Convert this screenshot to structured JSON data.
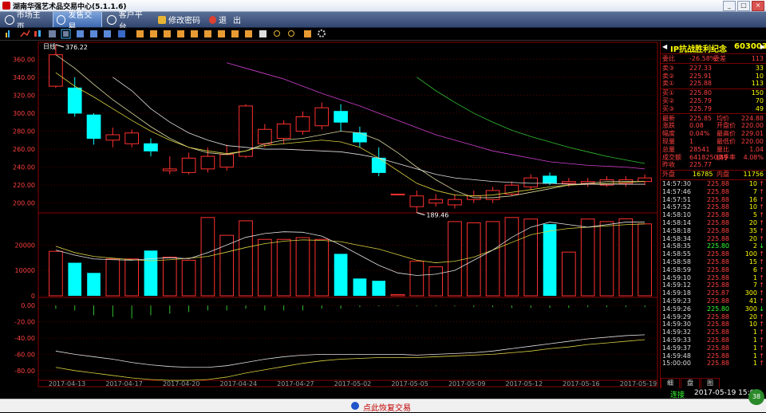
{
  "window": {
    "title": "湖南华强艺术品交易中心(5.1.1.6)"
  },
  "menu": [
    {
      "label": "市场主页",
      "icon": "globe-icon"
    },
    {
      "label": "发售交易",
      "icon": "globe-icon",
      "active": true
    },
    {
      "label": "客户平台",
      "icon": "globe-icon"
    },
    {
      "label": "修改密码",
      "icon": "lock-icon"
    },
    {
      "label": "退",
      "icon": "exit-icon"
    },
    {
      "label": "出",
      "icon": ""
    }
  ],
  "chart_data": {
    "type": "candlestick",
    "title": "日线",
    "price_axis": [
      360,
      340,
      320,
      300,
      280,
      260,
      240,
      220,
      200
    ],
    "volume_axis": [
      20000,
      10000,
      0
    ],
    "macd_axis": [
      "0.00",
      "-20.00",
      "-40.00",
      "-60.00",
      "-80.00"
    ],
    "macd_ylim": [
      -90,
      8
    ],
    "max_label": "376.22",
    "min_label": "189.46",
    "dates": [
      "2017-04-13",
      "2017-04-17",
      "2017-04-20",
      "2017-04-24",
      "2017-04-27",
      "2017-05-02",
      "2017-05-05",
      "2017-05-09",
      "2017-05-12",
      "2017-05-16",
      "2017-05-19"
    ],
    "candles": [
      {
        "o": 330,
        "c": 365,
        "h": 376.22,
        "l": 328,
        "v": 17500
      },
      {
        "o": 328,
        "c": 300,
        "h": 340,
        "l": 296,
        "v": 13000
      },
      {
        "o": 298,
        "c": 272,
        "h": 300,
        "l": 265,
        "v": 9000
      },
      {
        "o": 270,
        "c": 276,
        "h": 284,
        "l": 262,
        "v": 14500
      },
      {
        "o": 266,
        "c": 278,
        "h": 282,
        "l": 262,
        "v": 14500
      },
      {
        "o": 266,
        "c": 258,
        "h": 272,
        "l": 252,
        "v": 17800
      },
      {
        "o": 236,
        "c": 238,
        "h": 252,
        "l": 232,
        "v": 15200
      },
      {
        "o": 234,
        "c": 250,
        "h": 256,
        "l": 232,
        "v": 14000
      },
      {
        "o": 238,
        "c": 252,
        "h": 262,
        "l": 234,
        "v": 30800
      },
      {
        "o": 240,
        "c": 254,
        "h": 265,
        "l": 236,
        "v": 23800
      },
      {
        "o": 252,
        "c": 308,
        "h": 310,
        "l": 250,
        "v": 29500
      },
      {
        "o": 266,
        "c": 282,
        "h": 288,
        "l": 262,
        "v": 22200
      },
      {
        "o": 272,
        "c": 288,
        "h": 292,
        "l": 266,
        "v": 22200
      },
      {
        "o": 280,
        "c": 296,
        "h": 302,
        "l": 276,
        "v": 22900
      },
      {
        "o": 286,
        "c": 306,
        "h": 312,
        "l": 282,
        "v": 22200
      },
      {
        "o": 302,
        "c": 290,
        "h": 310,
        "l": 280,
        "v": 16500
      },
      {
        "o": 278,
        "c": 268,
        "h": 285,
        "l": 262,
        "v": 6800
      },
      {
        "o": 250,
        "c": 234,
        "h": 262,
        "l": 230,
        "v": 5900
      },
      {
        "o": 210,
        "c": 210,
        "h": 210,
        "l": 210,
        "v": 500
      },
      {
        "o": 196,
        "c": 208,
        "h": 214,
        "l": 189.46,
        "v": 13600
      },
      {
        "o": 200,
        "c": 204,
        "h": 210,
        "l": 196,
        "v": 11400
      },
      {
        "o": 198,
        "c": 204,
        "h": 210,
        "l": 194,
        "v": 29200
      },
      {
        "o": 204,
        "c": 208,
        "h": 214,
        "l": 200,
        "v": 28700
      },
      {
        "o": 204,
        "c": 214,
        "h": 218,
        "l": 200,
        "v": 29200
      },
      {
        "o": 210,
        "c": 220,
        "h": 224,
        "l": 208,
        "v": 30800
      },
      {
        "o": 218,
        "c": 228,
        "h": 232,
        "l": 214,
        "v": 30200
      },
      {
        "o": 230,
        "c": 222,
        "h": 234,
        "l": 220,
        "v": 28200
      },
      {
        "o": 222,
        "c": 224,
        "h": 228,
        "l": 218,
        "v": 17200
      },
      {
        "o": 222,
        "c": 224,
        "h": 228,
        "l": 218,
        "v": 30200
      },
      {
        "o": 220,
        "c": 226,
        "h": 230,
        "l": 218,
        "v": 29200
      },
      {
        "o": 222,
        "c": 226,
        "h": 230,
        "l": 218,
        "v": 30300
      },
      {
        "o": 224,
        "c": 228,
        "h": 232,
        "l": 220,
        "v": 28300
      }
    ],
    "ma_yellow": [
      345,
      330,
      318,
      305,
      292,
      280,
      270,
      262,
      258,
      255,
      258,
      264,
      266,
      268,
      270,
      268,
      262,
      250,
      236,
      222,
      214,
      209,
      208,
      209,
      212,
      215,
      218,
      220,
      221,
      222,
      223,
      224
    ],
    "ma_light": [
      365,
      350,
      332,
      315,
      300,
      285,
      272,
      262,
      256,
      254,
      258,
      266,
      270,
      272,
      276,
      280,
      278,
      270,
      256,
      240,
      226,
      214,
      206,
      206,
      208,
      212,
      216,
      220,
      222,
      224,
      224,
      224
    ],
    "ma_magenta": [
      null,
      null,
      null,
      null,
      null,
      null,
      null,
      null,
      null,
      356,
      350,
      344,
      338,
      330,
      322,
      315,
      308,
      300,
      292,
      284,
      276,
      270,
      264,
      258,
      254,
      250,
      246,
      244,
      242,
      241,
      240,
      238
    ],
    "ma_white_price": [
      null,
      null,
      null,
      340,
      325,
      305,
      290,
      278,
      270,
      264,
      262,
      260,
      260,
      259,
      258,
      257,
      254,
      250,
      244,
      238,
      232,
      228,
      226,
      224,
      223,
      222,
      222,
      221,
      221,
      221,
      221,
      221
    ],
    "ma_green": [
      null,
      null,
      null,
      null,
      null,
      null,
      null,
      null,
      null,
      null,
      null,
      null,
      null,
      null,
      null,
      null,
      null,
      null,
      null,
      340,
      325,
      312,
      300,
      290,
      281,
      274,
      268,
      262,
      257,
      252,
      248,
      244
    ],
    "vol_ma_yellow": [
      19500,
      17000,
      15500,
      14800,
      14200,
      13800,
      14200,
      14800,
      15500,
      17200,
      19000,
      20500,
      21500,
      22000,
      21800,
      21300,
      19800,
      18400,
      16200,
      14000,
      13000,
      13600,
      15200,
      18000,
      21000,
      24000,
      25500,
      26500,
      27000,
      27500,
      28000,
      28300
    ],
    "vol_ma_white": [
      18000,
      16000,
      14500,
      14200,
      14000,
      14600,
      15000,
      14600,
      17000,
      20000,
      23000,
      24500,
      25200,
      25000,
      23500,
      20000,
      16000,
      12000,
      9000,
      8000,
      8500,
      10000,
      14000,
      18000,
      23000,
      27000,
      29000,
      28000,
      27000,
      28000,
      29000,
      29000
    ],
    "macd_bars": [
      -4,
      -6,
      -12,
      -14,
      -16,
      -12,
      -10,
      -8,
      -6,
      -6,
      -4,
      -6,
      -6,
      -6,
      -4,
      -4,
      -2,
      -1,
      -1,
      -1,
      -1,
      -1,
      -2,
      -2,
      -3,
      -3,
      -3,
      -3,
      -2,
      -2,
      -2,
      -2
    ],
    "dif": [
      -56,
      -60,
      -63,
      -66,
      -70,
      -73,
      -75,
      -76,
      -76,
      -74,
      -70,
      -66,
      -63,
      -61,
      -60,
      -60,
      -60,
      -60,
      -60,
      -61,
      -60,
      -59,
      -58,
      -56,
      -53,
      -50,
      -47,
      -44,
      -41,
      -39,
      -37,
      -36
    ],
    "dea": [
      -76,
      -80,
      -83,
      -86,
      -89,
      -91,
      -92,
      -92,
      -91,
      -88,
      -83,
      -79,
      -75,
      -71,
      -68,
      -66,
      -65,
      -64,
      -64,
      -64,
      -63,
      -62,
      -61,
      -60,
      -58,
      -56,
      -53,
      -51,
      -48,
      -46,
      -44,
      -42
    ]
  },
  "quote": {
    "name": "IP抗战胜利纪念",
    "code": "603003",
    "ratio": {
      "l1": "委比",
      "v1": "-26.58%",
      "l2": "委差",
      "v2": "113"
    },
    "sell": [
      {
        "label": "卖③",
        "price": "227.33",
        "vol": "33"
      },
      {
        "label": "卖②",
        "price": "225.91",
        "vol": "10"
      },
      {
        "label": "卖①",
        "price": "225.88",
        "vol": "113"
      }
    ],
    "buy": [
      {
        "label": "买①",
        "price": "225.80",
        "vol": "150"
      },
      {
        "label": "买②",
        "price": "225.79",
        "vol": "70"
      },
      {
        "label": "买③",
        "price": "225.79",
        "vol": "49"
      }
    ],
    "stats": [
      {
        "l1": "最新",
        "v1": "225.85",
        "l2": "均价",
        "v2": "224.88"
      },
      {
        "l1": "涨跌",
        "v1": "0.08",
        "l2": "开盘价",
        "v2": "220.00"
      },
      {
        "l1": "幅度",
        "v1": "0.04%",
        "l2": "最高价",
        "v2": "229.01"
      },
      {
        "l1": "现量",
        "v1": "1",
        "l2": "最低价",
        "v2": "220.00"
      },
      {
        "l1": "总量",
        "v1": "28541",
        "l2": "量比",
        "v2": "1.04"
      },
      {
        "l1": "成交额",
        "v1": "6418250.49",
        "l2": "换手率",
        "v2": "4.08%"
      },
      {
        "l1": "昨收",
        "v1": "225.77",
        "l2": "",
        "v2": ""
      }
    ],
    "outer": {
      "l1": "外盘",
      "v1": "16785",
      "l2": "内盘",
      "v2": "11756"
    },
    "ticks": [
      {
        "t": "14:57:30",
        "p": "225.88",
        "v": "10",
        "d": "up"
      },
      {
        "t": "14:57:46",
        "p": "225.88",
        "v": "7",
        "d": "up"
      },
      {
        "t": "14:57:51",
        "p": "225.88",
        "v": "16",
        "d": "up"
      },
      {
        "t": "14:57:52",
        "p": "225.88",
        "v": "10",
        "d": "up"
      },
      {
        "t": "14:58:10",
        "p": "225.88",
        "v": "5",
        "d": "up"
      },
      {
        "t": "14:58:14",
        "p": "225.88",
        "v": "20",
        "d": "up"
      },
      {
        "t": "14:58:18",
        "p": "225.88",
        "v": "35",
        "d": "up"
      },
      {
        "t": "14:58:34",
        "p": "225.88",
        "v": "20",
        "d": "up"
      },
      {
        "t": "14:58:35",
        "p": "225.80",
        "v": "2",
        "d": "down"
      },
      {
        "t": "14:58:55",
        "p": "225.88",
        "v": "100",
        "d": "up"
      },
      {
        "t": "14:58:58",
        "p": "225.88",
        "v": "15",
        "d": "up"
      },
      {
        "t": "14:58:59",
        "p": "225.88",
        "v": "6",
        "d": "up"
      },
      {
        "t": "14:59:10",
        "p": "225.88",
        "v": "1",
        "d": "up"
      },
      {
        "t": "14:59:12",
        "p": "225.88",
        "v": "7",
        "d": "up"
      },
      {
        "t": "14:59:18",
        "p": "225.87",
        "v": "300",
        "d": "up"
      },
      {
        "t": "14:59:23",
        "p": "225.88",
        "v": "41",
        "d": "up"
      },
      {
        "t": "14:59:26",
        "p": "225.80",
        "v": "300",
        "d": "down"
      },
      {
        "t": "14:59:29",
        "p": "225.88",
        "v": "20",
        "d": "up"
      },
      {
        "t": "14:59:30",
        "p": "225.88",
        "v": "10",
        "d": "up"
      },
      {
        "t": "14:59:32",
        "p": "225.88",
        "v": "1",
        "d": "up"
      },
      {
        "t": "14:59:33",
        "p": "225.88",
        "v": "1",
        "d": "up"
      },
      {
        "t": "14:59:37",
        "p": "225.88",
        "v": "1",
        "d": "up"
      },
      {
        "t": "14:59:48",
        "p": "225.88",
        "v": "1",
        "d": "up"
      },
      {
        "t": "15:00:00",
        "p": "225.88",
        "v": "1",
        "d": "up"
      }
    ],
    "tabs": [
      "细",
      "盘",
      "图"
    ]
  },
  "status": {
    "conn": "连接",
    "datetime": "2017-05-19 15:00"
  },
  "bottom": {
    "label": "点此恢复交易"
  },
  "badge": "38"
}
